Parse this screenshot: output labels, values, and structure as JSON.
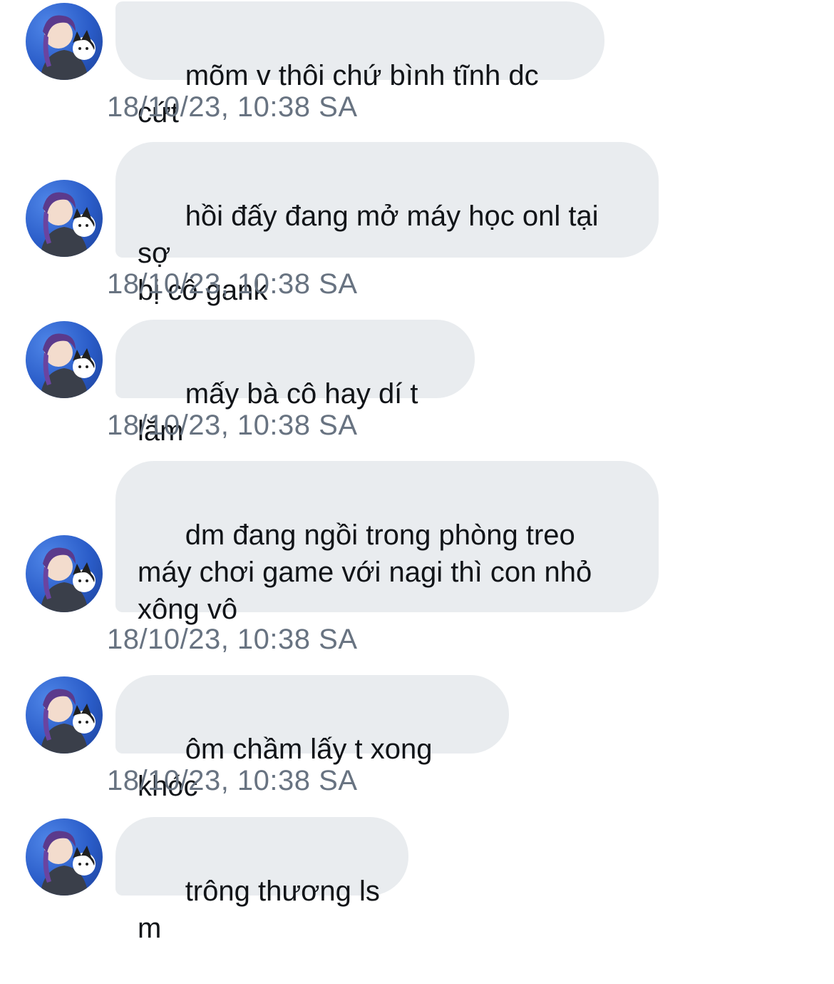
{
  "messages": [
    {
      "text": "mõm v thôi chứ bình tĩnh dc cứt",
      "time": "18/10/23, 10:38 SA"
    },
    {
      "text": "hồi đấy đang mở máy học onl tại sợ\nbị cô gank",
      "time": "18/10/23, 10:38 SA"
    },
    {
      "text": "mấy bà cô hay dí t lắm",
      "time": "18/10/23, 10:38 SA"
    },
    {
      "text": "dm đang ngồi trong phòng treo\nmáy chơi game với nagi thì con nhỏ\nxông vô",
      "time": "18/10/23, 10:38 SA"
    },
    {
      "text": "ôm chầm lấy t xong khóc",
      "time": "18/10/23, 10:38 SA"
    },
    {
      "text": "trông thương ls m",
      "time": ""
    }
  ],
  "colors": {
    "bubble_bg": "#e9ecef",
    "text": "#111418",
    "timestamp": "#687381",
    "avatar_bg": "#2a5cc8"
  },
  "icons": {
    "avatar": "avatar-icon"
  }
}
